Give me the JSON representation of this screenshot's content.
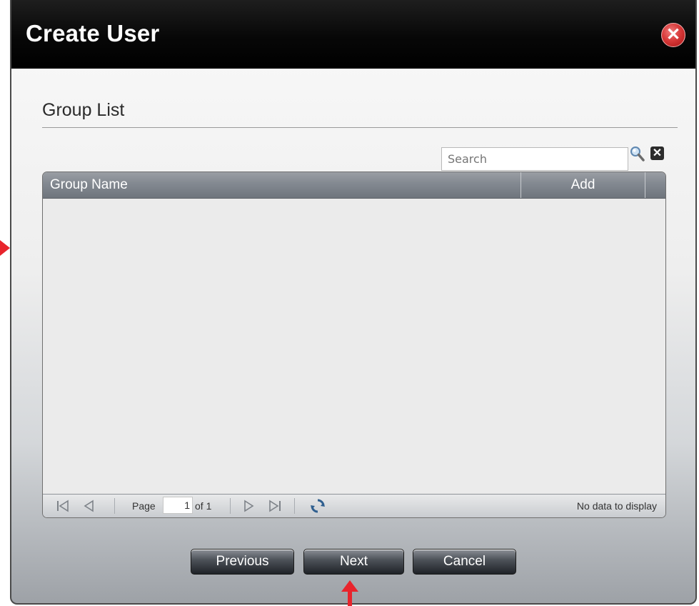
{
  "dialog": {
    "title": "Create User",
    "close_icon": "close-icon"
  },
  "section": {
    "title": "Group List"
  },
  "search": {
    "placeholder": "Search",
    "search_icon": "magnifier-icon",
    "clear_icon": "clear-icon",
    "clear_glyph": "✕"
  },
  "grid": {
    "columns": [
      "Group Name",
      "Add"
    ],
    "rows": []
  },
  "pager": {
    "page_label": "Page",
    "current_page": "1",
    "of_label": "of 1",
    "status": "No data to display",
    "icons": [
      "first-page-icon",
      "prev-page-icon",
      "next-page-icon",
      "last-page-icon",
      "refresh-icon"
    ]
  },
  "buttons": {
    "previous": "Previous",
    "next": "Next",
    "cancel": "Cancel"
  },
  "colors": {
    "titlebar": "#000000",
    "close": "#d83a3a",
    "annotation_arrow": "#e8242c",
    "grid_header": "#7b8189"
  }
}
